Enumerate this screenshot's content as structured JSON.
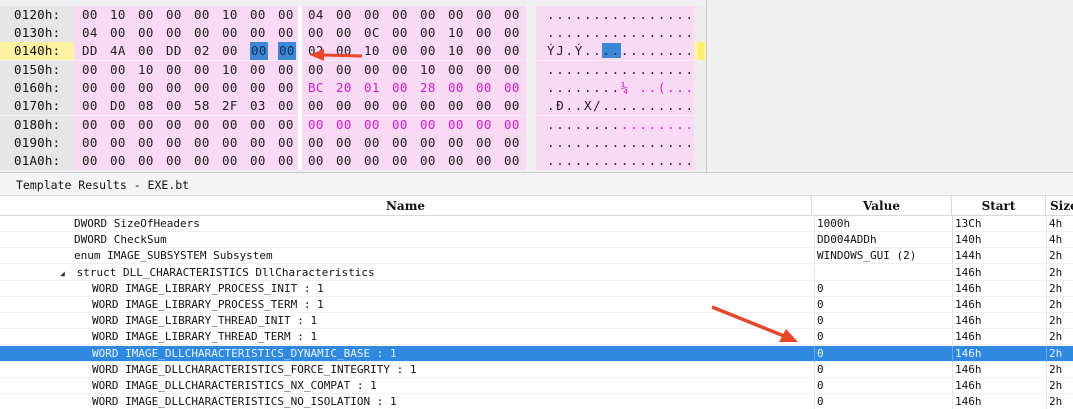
{
  "hex": {
    "rows": [
      {
        "addr": "0120h:",
        "bytes": [
          "00",
          "10",
          "00",
          "00",
          "00",
          "10",
          "00",
          "00",
          "04",
          "00",
          "00",
          "00",
          "00",
          "00",
          "00",
          "00"
        ],
        "ascii": "................"
      },
      {
        "addr": "0130h:",
        "bytes": [
          "04",
          "00",
          "00",
          "00",
          "00",
          "00",
          "00",
          "00",
          "00",
          "00",
          "0C",
          "00",
          "00",
          "10",
          "00",
          "00"
        ],
        "ascii": "................"
      },
      {
        "addr": "0140h:",
        "bytes": [
          "DD",
          "4A",
          "00",
          "DD",
          "02",
          "00",
          "00",
          "00",
          "02",
          "00",
          "10",
          "00",
          "00",
          "10",
          "00",
          "00"
        ],
        "ascii": "ÝJ.Ý............"
      },
      {
        "addr": "0150h:",
        "bytes": [
          "00",
          "00",
          "10",
          "00",
          "00",
          "10",
          "00",
          "00",
          "00",
          "00",
          "00",
          "00",
          "10",
          "00",
          "00",
          "00"
        ],
        "ascii": "................"
      },
      {
        "addr": "0160h:",
        "bytes": [
          "00",
          "00",
          "00",
          "00",
          "00",
          "00",
          "00",
          "00",
          "BC",
          "20",
          "01",
          "00",
          "28",
          "00",
          "00",
          "00"
        ],
        "ascii": "........¼ ..(..."
      },
      {
        "addr": "0170h:",
        "bytes": [
          "00",
          "D0",
          "08",
          "00",
          "58",
          "2F",
          "03",
          "00",
          "00",
          "00",
          "00",
          "00",
          "00",
          "00",
          "00",
          "00"
        ],
        "ascii": ".Ð..X/.........."
      },
      {
        "addr": "0180h:",
        "bytes": [
          "00",
          "00",
          "00",
          "00",
          "00",
          "00",
          "00",
          "00",
          "00",
          "00",
          "00",
          "00",
          "00",
          "00",
          "00",
          "00"
        ],
        "ascii": "................"
      },
      {
        "addr": "0190h:",
        "bytes": [
          "00",
          "00",
          "00",
          "00",
          "00",
          "00",
          "00",
          "00",
          "00",
          "00",
          "00",
          "00",
          "00",
          "00",
          "00",
          "00"
        ],
        "ascii": "................"
      },
      {
        "addr": "01A0h:",
        "bytes": [
          "00",
          "00",
          "00",
          "00",
          "00",
          "00",
          "00",
          "00",
          "00",
          "00",
          "00",
          "00",
          "00",
          "00",
          "00",
          "00"
        ],
        "ascii": "................"
      }
    ],
    "pink_ranges": {
      "0160h:": [
        8,
        15
      ],
      "0180h:": [
        8,
        15
      ]
    },
    "selected_bytes": {
      "row": 2,
      "indices": [
        6,
        7
      ]
    },
    "cursor_row": 2,
    "colors": {
      "hex_bg": "#fad9f4",
      "selection": "#3a88d6",
      "pink_text": "#d020d0",
      "arrow": "#e8472a"
    }
  },
  "template": {
    "title": "Template Results - EXE.bt",
    "columns": {
      "name": "Name",
      "value": "Value",
      "start": "Start",
      "size": "Size"
    },
    "rows": [
      {
        "indent": 0,
        "toggle": "",
        "name": "DWORD SizeOfHeaders",
        "value": "1000h",
        "start": "13Ch",
        "size": "4h"
      },
      {
        "indent": 0,
        "toggle": "",
        "name": "DWORD CheckSum",
        "value": "DD004ADDh",
        "start": "140h",
        "size": "4h"
      },
      {
        "indent": 0,
        "toggle": "",
        "name": "enum IMAGE_SUBSYSTEM Subsystem",
        "value": "WINDOWS_GUI (2)",
        "start": "144h",
        "size": "2h"
      },
      {
        "indent": 0,
        "toggle": "◢",
        "name": "struct DLL_CHARACTERISTICS DllCharacteristics",
        "value": "",
        "start": "146h",
        "size": "2h"
      },
      {
        "indent": 1,
        "toggle": "",
        "name": "WORD IMAGE_LIBRARY_PROCESS_INIT : 1",
        "value": "0",
        "start": "146h",
        "size": "2h"
      },
      {
        "indent": 1,
        "toggle": "",
        "name": "WORD IMAGE_LIBRARY_PROCESS_TERM : 1",
        "value": "0",
        "start": "146h",
        "size": "2h"
      },
      {
        "indent": 1,
        "toggle": "",
        "name": "WORD IMAGE_LIBRARY_THREAD_INIT : 1",
        "value": "0",
        "start": "146h",
        "size": "2h"
      },
      {
        "indent": 1,
        "toggle": "",
        "name": "WORD IMAGE_LIBRARY_THREAD_TERM : 1",
        "value": "0",
        "start": "146h",
        "size": "2h"
      },
      {
        "indent": 1,
        "toggle": "",
        "name": "WORD IMAGE_DLLCHARACTERISTICS_DYNAMIC_BASE : 1",
        "value": "0",
        "start": "146h",
        "size": "2h",
        "selected": true
      },
      {
        "indent": 1,
        "toggle": "",
        "name": "WORD IMAGE_DLLCHARACTERISTICS_FORCE_INTEGRITY : 1",
        "value": "0",
        "start": "146h",
        "size": "2h"
      },
      {
        "indent": 1,
        "toggle": "",
        "name": "WORD IMAGE_DLLCHARACTERISTICS_NX_COMPAT : 1",
        "value": "0",
        "start": "146h",
        "size": "2h"
      },
      {
        "indent": 1,
        "toggle": "",
        "name": "WORD IMAGE_DLLCHARACTERISTICS_NO_ISOLATION : 1",
        "value": "0",
        "start": "146h",
        "size": "2h"
      }
    ],
    "colors": {
      "selected_row": "#3089e0"
    }
  }
}
